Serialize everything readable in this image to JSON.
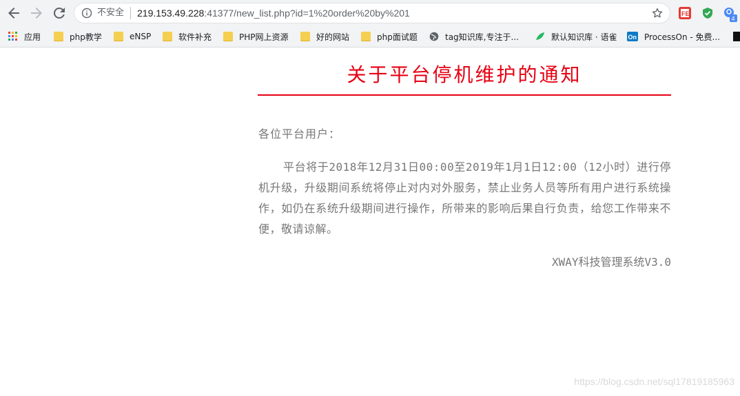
{
  "browser": {
    "security_label": "不安全",
    "url_host": "219.153.49.228",
    "url_rest": ":41377/new_list.php?id=1%20order%20by%201",
    "ext_badge_count": "4",
    "bookmarks": [
      {
        "label": "应用",
        "icon": "apps-grid-icon"
      },
      {
        "label": "php教学",
        "icon": "folder-icon"
      },
      {
        "label": "eNSP",
        "icon": "folder-icon"
      },
      {
        "label": "软件补充",
        "icon": "folder-icon"
      },
      {
        "label": "PHP网上资源",
        "icon": "folder-icon"
      },
      {
        "label": "好的网站",
        "icon": "folder-icon"
      },
      {
        "label": "php面试题",
        "icon": "folder-icon"
      },
      {
        "label": "tag知识库,专注于...",
        "icon": "globe-icon"
      },
      {
        "label": "默认知识库 · 语雀",
        "icon": "yuque-icon"
      },
      {
        "label": "ProcessOn - 免费...",
        "icon": "processon-icon"
      }
    ]
  },
  "notice": {
    "title": "关于平台停机维护的通知",
    "greeting": "各位平台用户：",
    "body": "平台将于2018年12月31日00:00至2019年1月1日12:00（12小时）进行停机升级，升级期间系统将停止对内对外服务，禁止业务人员等所有用户进行系统操作，如仍在系统升级期间进行操作，所带来的影响后果自行负责，给您工作带来不便，敬请谅解。",
    "signature": "XWAY科技管理系统V3.0"
  },
  "watermark": "https://blog.csdn.net/sql17819185963",
  "colors": {
    "title_red": "#e60012",
    "body_gray": "#777777",
    "chrome_bg": "#f1f3f4"
  }
}
